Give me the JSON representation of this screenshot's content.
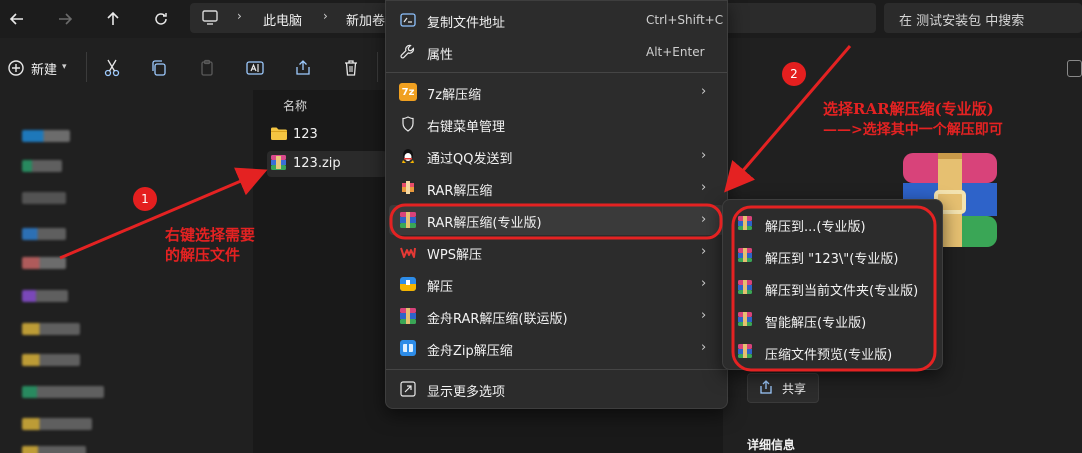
{
  "addressbar": {
    "crumbs": [
      "此电脑",
      "新加卷"
    ],
    "search_placeholder": "在 测试安装包 中搜索"
  },
  "toolbar": {
    "new_label": "新建"
  },
  "filepane": {
    "column_name": "名称",
    "files": [
      {
        "name": "123",
        "icon": "folder-icon"
      },
      {
        "name": "123.zip",
        "icon": "rar-archive-icon"
      }
    ]
  },
  "context_menu": {
    "items": [
      {
        "label": "复制文件地址",
        "shortcut": "Ctrl+Shift+C",
        "icon": "copy-path-icon"
      },
      {
        "label": "属性",
        "shortcut": "Alt+Enter",
        "icon": "wrench-icon"
      },
      {
        "label": "7z解压缩",
        "icon": "7z-icon",
        "submenu": true
      },
      {
        "label": "右键菜单管理",
        "icon": "shield-icon"
      },
      {
        "label": "通过QQ发送到",
        "icon": "qq-penguin-icon",
        "submenu": true
      },
      {
        "label": "RAR解压缩",
        "icon": "rar-icon",
        "submenu": true
      },
      {
        "label": "RAR解压缩(专业版)",
        "icon": "rar-pro-icon",
        "submenu": true
      },
      {
        "label": "WPS解压",
        "icon": "wps-icon",
        "submenu": true
      },
      {
        "label": "解压",
        "icon": "unzip-icon",
        "submenu": true
      },
      {
        "label": "金舟RAR解压缩(联运版)",
        "icon": "jinzhou-rar-icon",
        "submenu": true
      },
      {
        "label": "金舟Zip解压缩",
        "icon": "jinzhou-zip-icon",
        "submenu": true
      },
      {
        "label": "显示更多选项",
        "icon": "more-options-icon"
      }
    ]
  },
  "submenu": {
    "items": [
      {
        "label": "解压到...(专业版)"
      },
      {
        "label": "解压到 \"123\\\"(专业版)"
      },
      {
        "label": "解压到当前文件夹(专业版)"
      },
      {
        "label": "智能解压(专业版)"
      },
      {
        "label": "压缩文件预览(专业版)"
      }
    ]
  },
  "details": {
    "share_label": "共享",
    "details_label": "详细信息"
  },
  "annotations": {
    "badge1": "1",
    "badge2": "2",
    "text1_line1": "右键选择需要",
    "text1_line2": "的解压文件",
    "text2_line1": "选择RAR解压缩(专业版)",
    "text2_line2": "——>选择其中一个解压即可"
  },
  "colors": {
    "annotation_red": "#e42222",
    "menu_bg": "#2c2c2c",
    "app_bg": "#202020"
  }
}
